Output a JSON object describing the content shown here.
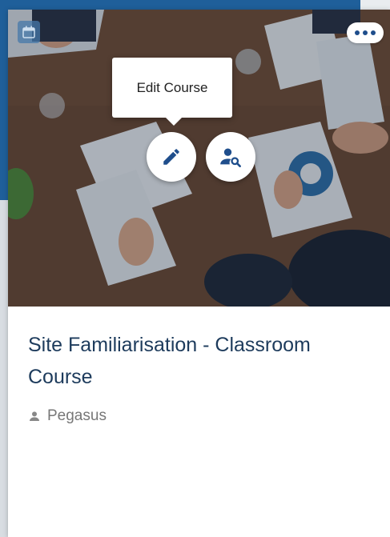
{
  "card": {
    "tooltip": "Edit Course",
    "title": "Site Familiarisation - Classroom Course",
    "owner": "Pegasus"
  },
  "icons": {
    "calendar": "calendar-icon",
    "more": "more-horizontal-icon",
    "edit": "pencil-icon",
    "view_users": "user-search-icon",
    "owner": "person-icon"
  },
  "colors": {
    "accent": "#1f4e8c",
    "title": "#1d3b5c",
    "header_band": "#1f5f9a"
  }
}
